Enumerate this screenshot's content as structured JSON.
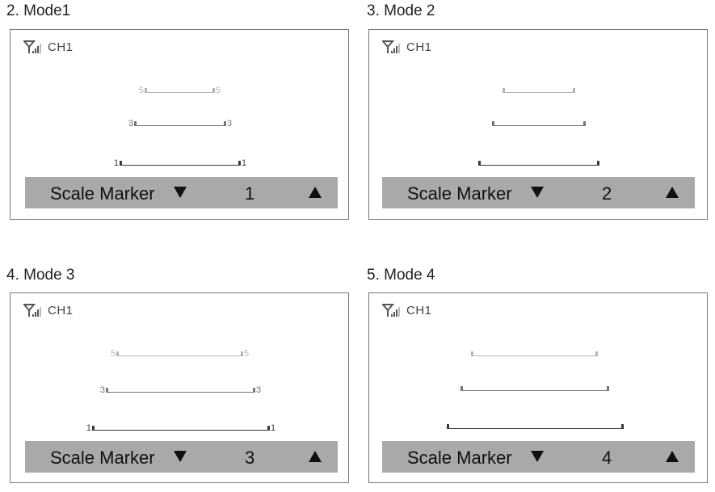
{
  "captions": [
    "2. Mode1",
    "3. Mode 2",
    "4. Mode 3",
    "5. Mode 4"
  ],
  "panels": [
    {
      "status": {
        "icon": "signal-antenna-icon",
        "channel": "CH1"
      },
      "markers": {
        "m5": {
          "left": "5",
          "right": "5"
        },
        "m3": {
          "left": "3",
          "right": "3"
        },
        "m1": {
          "left": "1",
          "right": "1"
        }
      },
      "bar": {
        "title": "Scale Marker",
        "value": "1",
        "down_icon": "triangle-down-icon",
        "up_icon": "triangle-up-icon"
      }
    },
    {
      "status": {
        "icon": "signal-antenna-icon",
        "channel": "CH1"
      },
      "markers": {
        "m5": {
          "left": "",
          "right": ""
        },
        "m3": {
          "left": "",
          "right": ""
        },
        "m1": {
          "left": "",
          "right": ""
        }
      },
      "bar": {
        "title": "Scale Marker",
        "value": "2",
        "down_icon": "triangle-down-icon",
        "up_icon": "triangle-up-icon"
      }
    },
    {
      "status": {
        "icon": "signal-antenna-icon",
        "channel": "CH1"
      },
      "markers": {
        "m5": {
          "left": "5",
          "right": "5"
        },
        "m3": {
          "left": "3",
          "right": "3"
        },
        "m1": {
          "left": "1",
          "right": "1"
        }
      },
      "bar": {
        "title": "Scale Marker",
        "value": "3",
        "down_icon": "triangle-down-icon",
        "up_icon": "triangle-up-icon"
      }
    },
    {
      "status": {
        "icon": "signal-antenna-icon",
        "channel": "CH1"
      },
      "markers": {
        "m5": {
          "left": "",
          "right": ""
        },
        "m3": {
          "left": "",
          "right": ""
        },
        "m1": {
          "left": "",
          "right": ""
        }
      },
      "bar": {
        "title": "Scale Marker",
        "value": "4",
        "down_icon": "triangle-down-icon",
        "up_icon": "triangle-up-icon"
      }
    }
  ],
  "colors": {
    "bar_background": "#a9a9a9",
    "marker_5": "#b4b4b4",
    "marker_3": "#777777",
    "marker_1": "#3a3a3a"
  }
}
